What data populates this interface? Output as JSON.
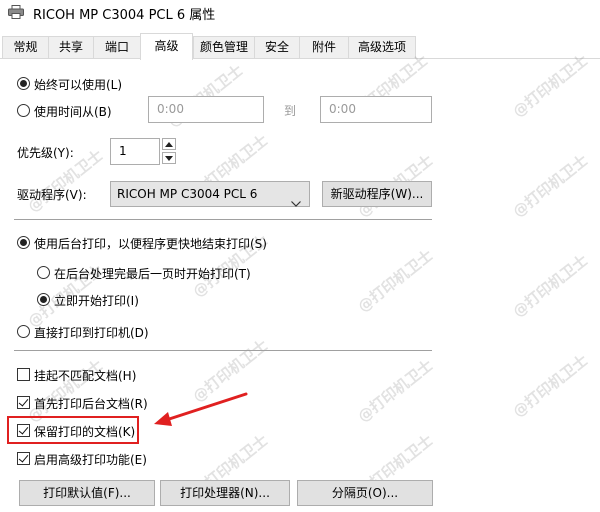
{
  "window": {
    "title": "RICOH MP C3004 PCL 6 属性"
  },
  "tabs": [
    {
      "label": "常规"
    },
    {
      "label": "共享"
    },
    {
      "label": "端口"
    },
    {
      "label": "高级"
    },
    {
      "label": "颜色管理"
    },
    {
      "label": "安全"
    },
    {
      "label": "附件"
    },
    {
      "label": "高级选项"
    }
  ],
  "availability": {
    "always_label": "始终可以使用(L)",
    "from_label": "使用时间从(B)",
    "from_value": "0:00",
    "to_label": "到",
    "to_value": "0:00"
  },
  "priority": {
    "label": "优先级(Y):",
    "value": "1"
  },
  "driver": {
    "label": "驱动程序(V):",
    "value": "RICOH MP C3004 PCL 6",
    "new_button": "新驱动程序(W)..."
  },
  "spool": {
    "spool_label": "使用后台打印，以便程序更快地结束打印(S)",
    "after_last_label": "在后台处理完最后一页时开始打印(T)",
    "immediate_label": "立即开始打印(I)",
    "direct_label": "直接打印到打印机(D)"
  },
  "options": {
    "hold_mismatch": "挂起不匹配文档(H)",
    "spooled_first": "首先打印后台文档(R)",
    "keep_printed": "保留打印的文档(K)",
    "advanced_features": "启用高级打印功能(E)"
  },
  "buttons": {
    "defaults": "打印默认值(F)...",
    "processor": "打印处理器(N)...",
    "separator": "分隔页(O)..."
  },
  "watermark_text": "@打印机卫士",
  "colors": {
    "annotation": "#e02020"
  }
}
